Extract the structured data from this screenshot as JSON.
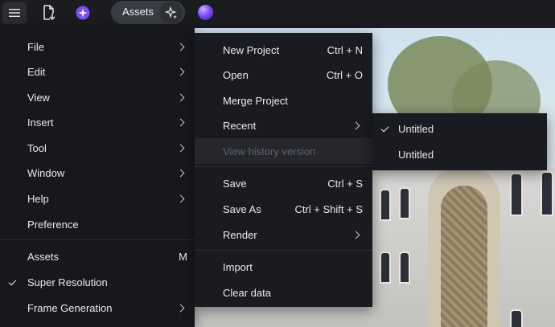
{
  "toolbar": {
    "assets_label": "Assets",
    "icons": [
      "hamburger-icon",
      "file-export-icon",
      "ai-sparkle-badge-icon",
      "sparkle-icon",
      "orb-avatar"
    ],
    "accent": "#7a4dff"
  },
  "main_menu": {
    "items": [
      {
        "label": "File",
        "submenu": true
      },
      {
        "label": "Edit",
        "submenu": true
      },
      {
        "label": "View",
        "submenu": true
      },
      {
        "label": "Insert",
        "submenu": true
      },
      {
        "label": "Tool",
        "submenu": true
      },
      {
        "label": "Window",
        "submenu": true
      },
      {
        "label": "Help",
        "submenu": true
      },
      {
        "label": "Preference",
        "submenu": false
      },
      {
        "label": "Assets",
        "shortcut": "M"
      },
      {
        "label": "Super Resolution",
        "checked": true
      },
      {
        "label": "Frame Generation",
        "submenu": true
      }
    ]
  },
  "file_menu": {
    "items": [
      {
        "label": "New Project",
        "shortcut": "Ctrl + N"
      },
      {
        "label": "Open",
        "shortcut": "Ctrl + O"
      },
      {
        "label": "Merge Project"
      },
      {
        "label": "Recent",
        "submenu": true
      },
      {
        "label": "View history version",
        "disabled": true
      },
      {
        "label": "Save",
        "shortcut": "Ctrl + S"
      },
      {
        "label": "Save As",
        "shortcut": "Ctrl + Shift + S"
      },
      {
        "label": "Render",
        "submenu": true
      },
      {
        "label": "Import"
      },
      {
        "label": "Clear data"
      }
    ]
  },
  "recent_menu": {
    "items": [
      {
        "label": "Untitled",
        "checked": true
      },
      {
        "label": "Untitled",
        "checked": false
      }
    ]
  }
}
